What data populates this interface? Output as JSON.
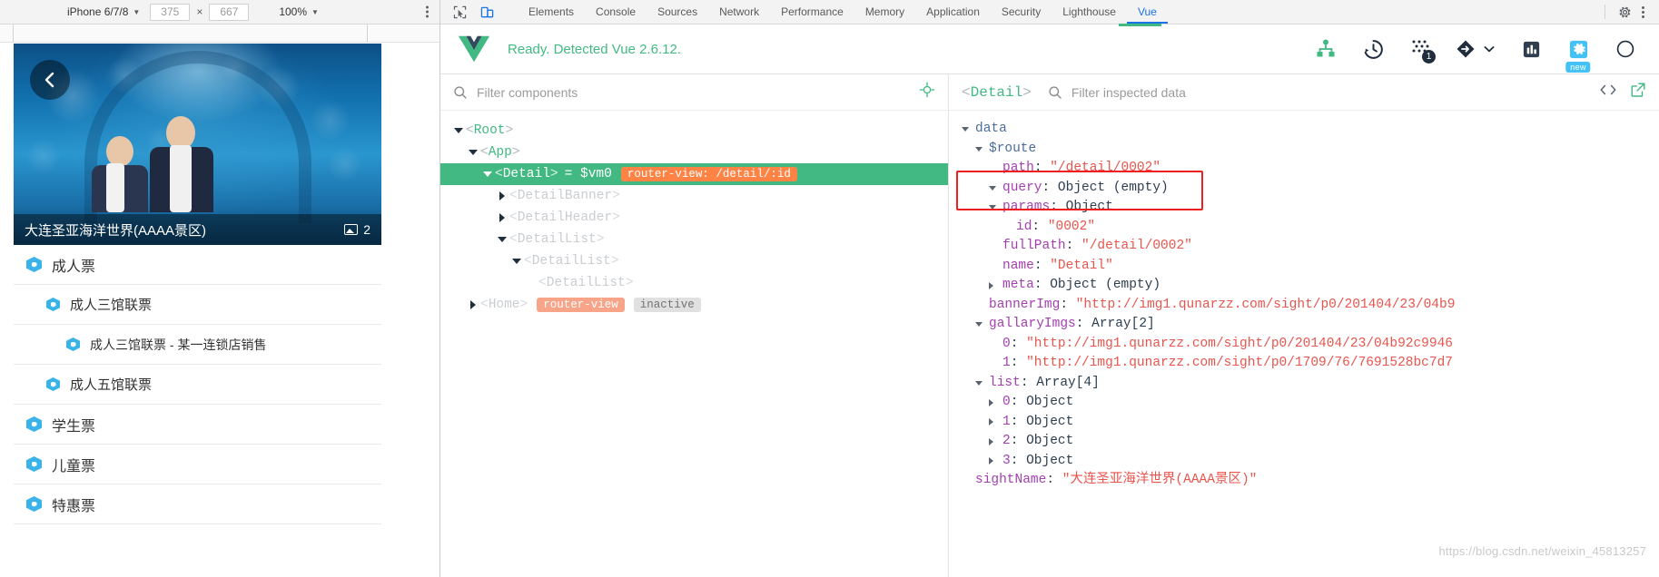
{
  "device_toolbar": {
    "device_name": "iPhone 6/7/8",
    "width": "375",
    "height": "667",
    "times": "×",
    "zoom": "100%",
    "caret": "▼"
  },
  "phone": {
    "banner": {
      "title": "大连圣亚海洋世界(AAAA景区)",
      "image_count": "2"
    },
    "list": [
      {
        "label": "成人票",
        "level": 0
      },
      {
        "label": "成人三馆联票",
        "level": 1
      },
      {
        "label": "成人三馆联票 - 某一连锁店销售",
        "level": 2
      },
      {
        "label": "成人五馆联票",
        "level": 1
      },
      {
        "label": "学生票",
        "level": 0
      },
      {
        "label": "儿童票",
        "level": 0
      },
      {
        "label": "特惠票",
        "level": 0
      }
    ]
  },
  "devtools": {
    "tabs": [
      {
        "label": "Elements",
        "active": false
      },
      {
        "label": "Console",
        "active": false
      },
      {
        "label": "Sources",
        "active": false
      },
      {
        "label": "Network",
        "active": false
      },
      {
        "label": "Performance",
        "active": false
      },
      {
        "label": "Memory",
        "active": false
      },
      {
        "label": "Application",
        "active": false
      },
      {
        "label": "Security",
        "active": false
      },
      {
        "label": "Lighthouse",
        "active": false
      },
      {
        "label": "Vue",
        "active": true
      }
    ]
  },
  "vue_panel": {
    "status": "Ready. Detected Vue 2.6.12.",
    "accent_green": "#42b983",
    "badge_count": "1",
    "new_badge": "new",
    "filter_placeholder": "Filter components",
    "inspect_placeholder": "Filter inspected data",
    "inspected_component": "Detail"
  },
  "component_tree": [
    {
      "name": "Root",
      "indent": 0,
      "toggle": "down",
      "selected": false,
      "vm": "",
      "pill": "",
      "pill2": ""
    },
    {
      "name": "App",
      "indent": 1,
      "toggle": "down",
      "selected": false,
      "vm": "",
      "pill": "",
      "pill2": ""
    },
    {
      "name": "Detail",
      "indent": 2,
      "toggle": "down",
      "selected": true,
      "vm": "= $vm0",
      "pill": "router-view: /detail/:id",
      "pill2": ""
    },
    {
      "name": "DetailBanner",
      "indent": 3,
      "toggle": "right",
      "selected": false,
      "vm": "",
      "pill": "",
      "pill2": ""
    },
    {
      "name": "DetailHeader",
      "indent": 3,
      "toggle": "right",
      "selected": false,
      "vm": "",
      "pill": "",
      "pill2": ""
    },
    {
      "name": "DetailList",
      "indent": 3,
      "toggle": "down",
      "selected": false,
      "vm": "",
      "pill": "",
      "pill2": ""
    },
    {
      "name": "DetailList",
      "indent": 4,
      "toggle": "down",
      "selected": false,
      "vm": "",
      "pill": "",
      "pill2": ""
    },
    {
      "name": "DetailList",
      "indent": 5,
      "toggle": "none",
      "selected": false,
      "vm": "",
      "pill": "",
      "pill2": ""
    },
    {
      "name": "Home",
      "indent": 2,
      "toggle": "right",
      "selected": false,
      "vm": "",
      "pill": "router-view",
      "pill2": "inactive"
    }
  ],
  "inspected_data": {
    "root_label": "data",
    "rows": [
      {
        "indent": 0,
        "toggle": "down",
        "key": "data",
        "keyclass": "k-blue",
        "sep": "",
        "value": "",
        "valclass": ""
      },
      {
        "indent": 1,
        "toggle": "down",
        "key": "$route",
        "keyclass": "k-blue",
        "sep": "",
        "value": "",
        "valclass": ""
      },
      {
        "indent": 2,
        "toggle": "none",
        "key": "path",
        "keyclass": "k-purple",
        "sep": ": ",
        "value": "\"/detail/0002\"",
        "valclass": "v-red"
      },
      {
        "indent": 2,
        "toggle": "down",
        "key": "query",
        "keyclass": "k-purple",
        "sep": ": ",
        "value": "Object (empty)",
        "valclass": "v-gray"
      },
      {
        "indent": 2,
        "toggle": "down",
        "key": "params",
        "keyclass": "k-purple",
        "sep": ": ",
        "value": "Object",
        "valclass": "v-gray"
      },
      {
        "indent": 3,
        "toggle": "none",
        "key": "id",
        "keyclass": "k-purple",
        "sep": ": ",
        "value": "\"0002\"",
        "valclass": "v-red"
      },
      {
        "indent": 2,
        "toggle": "none",
        "key": "fullPath",
        "keyclass": "k-purple",
        "sep": ": ",
        "value": "\"/detail/0002\"",
        "valclass": "v-red"
      },
      {
        "indent": 2,
        "toggle": "none",
        "key": "name",
        "keyclass": "k-purple",
        "sep": ": ",
        "value": "\"Detail\"",
        "valclass": "v-red"
      },
      {
        "indent": 2,
        "toggle": "right",
        "key": "meta",
        "keyclass": "k-purple",
        "sep": ": ",
        "value": "Object (empty)",
        "valclass": "v-gray"
      },
      {
        "indent": 1,
        "toggle": "none",
        "key": "bannerImg",
        "keyclass": "k-purple",
        "sep": ": ",
        "value": "\"http://img1.qunarzz.com/sight/p0/201404/23/04b9",
        "valclass": "v-red"
      },
      {
        "indent": 1,
        "toggle": "down",
        "key": "gallaryImgs",
        "keyclass": "k-purple",
        "sep": ": ",
        "value": "Array[2]",
        "valclass": "v-gray"
      },
      {
        "indent": 2,
        "toggle": "none",
        "key": "0",
        "keyclass": "k-purple",
        "sep": ": ",
        "value": "\"http://img1.qunarzz.com/sight/p0/201404/23/04b92c9946",
        "valclass": "v-red"
      },
      {
        "indent": 2,
        "toggle": "none",
        "key": "1",
        "keyclass": "k-purple",
        "sep": ": ",
        "value": "\"http://img1.qunarzz.com/sight/p0/1709/76/7691528bc7d7",
        "valclass": "v-red"
      },
      {
        "indent": 1,
        "toggle": "down",
        "key": "list",
        "keyclass": "k-purple",
        "sep": ": ",
        "value": "Array[4]",
        "valclass": "v-gray"
      },
      {
        "indent": 2,
        "toggle": "right",
        "key": "0",
        "keyclass": "k-purple",
        "sep": ": ",
        "value": "Object",
        "valclass": "v-gray"
      },
      {
        "indent": 2,
        "toggle": "right",
        "key": "1",
        "keyclass": "k-purple",
        "sep": ": ",
        "value": "Object",
        "valclass": "v-gray"
      },
      {
        "indent": 2,
        "toggle": "right",
        "key": "2",
        "keyclass": "k-purple",
        "sep": ": ",
        "value": "Object",
        "valclass": "v-gray"
      },
      {
        "indent": 2,
        "toggle": "right",
        "key": "3",
        "keyclass": "k-purple",
        "sep": ": ",
        "value": "Object",
        "valclass": "v-gray"
      },
      {
        "indent": 1,
        "toggle": "none",
        "key": "sightName",
        "keyclass": "k-purple",
        "sep": ": ",
        "value": "\"大连圣亚海洋世界(AAAA景区)\"",
        "valclass": "v-red"
      }
    ]
  },
  "watermark": "https://blog.csdn.net/weixin_45813257"
}
